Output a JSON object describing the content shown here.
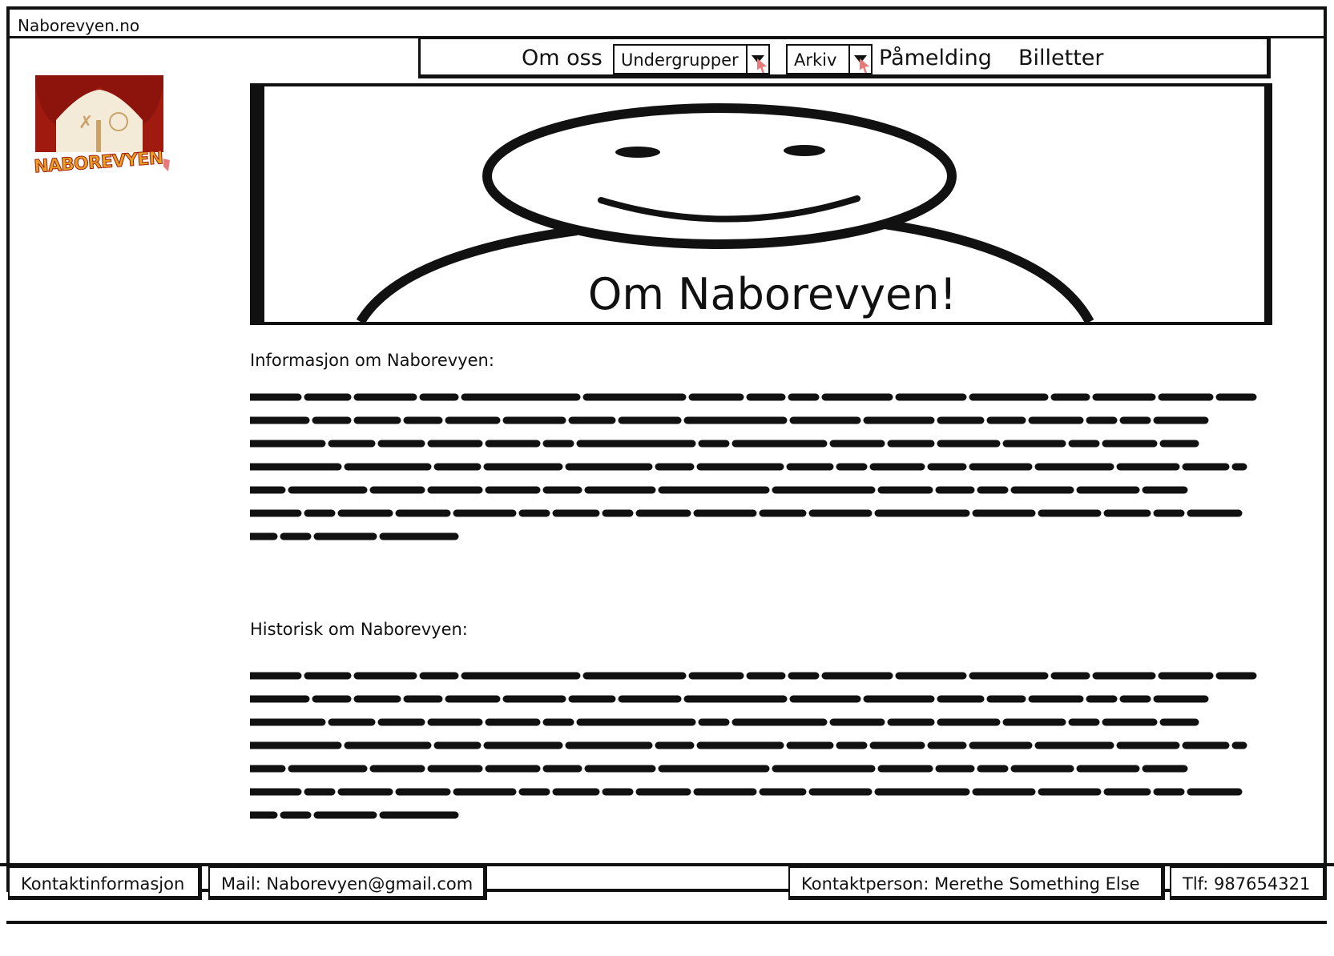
{
  "browser": {
    "url": "Naborevyen.no"
  },
  "nav": {
    "om_oss": "Om oss",
    "undergrupper": "Undergrupper",
    "arkiv": "Arkiv",
    "pamelding": "Påmelding",
    "billetter": "Billetter"
  },
  "logo": {
    "text": "NABOREVYEN",
    "colors": {
      "curtain": "#a01a10",
      "text": "#e8a020"
    }
  },
  "hero": {
    "title": "Om Naborevyen!"
  },
  "sections": {
    "info_heading": "Informasjon om Naborevyen:",
    "history_heading": "Historisk om Naborevyen:"
  },
  "footer": {
    "contact": "Kontaktinformasjon",
    "mail": "Mail: Naborevyen@gmail.com",
    "person": "Kontaktperson: Merethe Something Else",
    "phone": "Tlf: 987654321"
  }
}
